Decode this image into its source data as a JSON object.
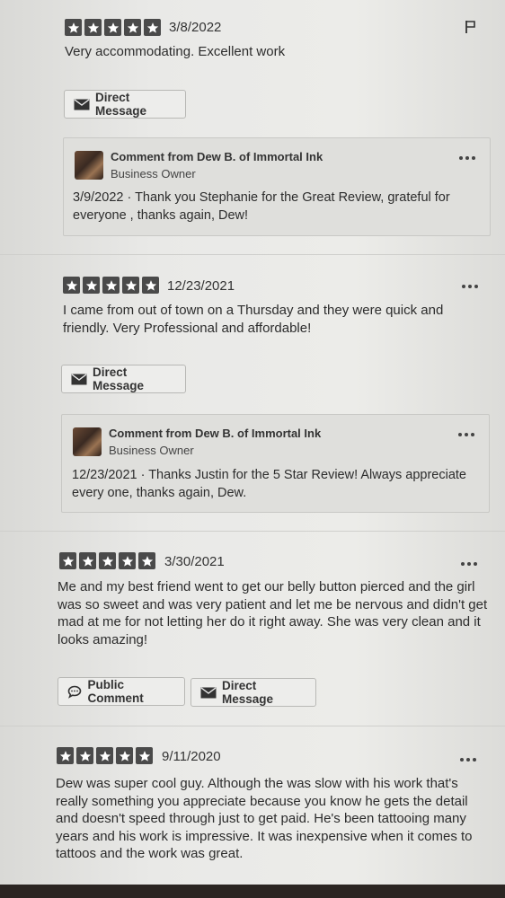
{
  "reviews": [
    {
      "stars": 5,
      "date": "3/8/2022",
      "text": "Very accommodating. Excellent work",
      "buttons": [
        "Direct Message"
      ],
      "comment": {
        "title": "Comment from Dew B. of Immortal Ink",
        "role": "Business Owner",
        "text": "3/9/2022  ·  Thank you Stephanie for the Great Review, grateful for everyone , thanks again, Dew!"
      }
    },
    {
      "stars": 5,
      "date": "12/23/2021",
      "text": "I came from out of town on a Thursday and they were quick and friendly. Very Professional and affordable!",
      "buttons": [
        "Direct Message"
      ],
      "comment": {
        "title": "Comment from Dew B. of Immortal Ink",
        "role": "Business Owner",
        "text": "12/23/2021  ·  Thanks Justin for the 5 Star Review! Always appreciate every one, thanks again, Dew."
      }
    },
    {
      "stars": 5,
      "date": "3/30/2021",
      "text": "Me and my best friend went to get our belly button pierced and the girl was so sweet and was very patient and let me be nervous and didn't get mad at me for not letting her do it right away. She was very clean and it looks amazing!",
      "buttons": [
        "Public Comment",
        "Direct Message"
      ]
    },
    {
      "stars": 5,
      "date": "9/11/2020",
      "text": "Dew was super cool guy. Although the was slow with his work that's really something you appreciate because you know he gets the detail and doesn't speed through just to get paid. He's been tattooing many years and his work is impressive. It was inexpensive when it comes to tattoos and the work was great."
    }
  ],
  "icons": {
    "star": "star-icon",
    "envelope": "envelope-icon",
    "speech": "speech-bubble-icon",
    "more": "more-options-icon",
    "flag": "flag-icon"
  },
  "colors": {
    "star_bg": "#4a4a4a",
    "background": "#e6e6e3"
  }
}
